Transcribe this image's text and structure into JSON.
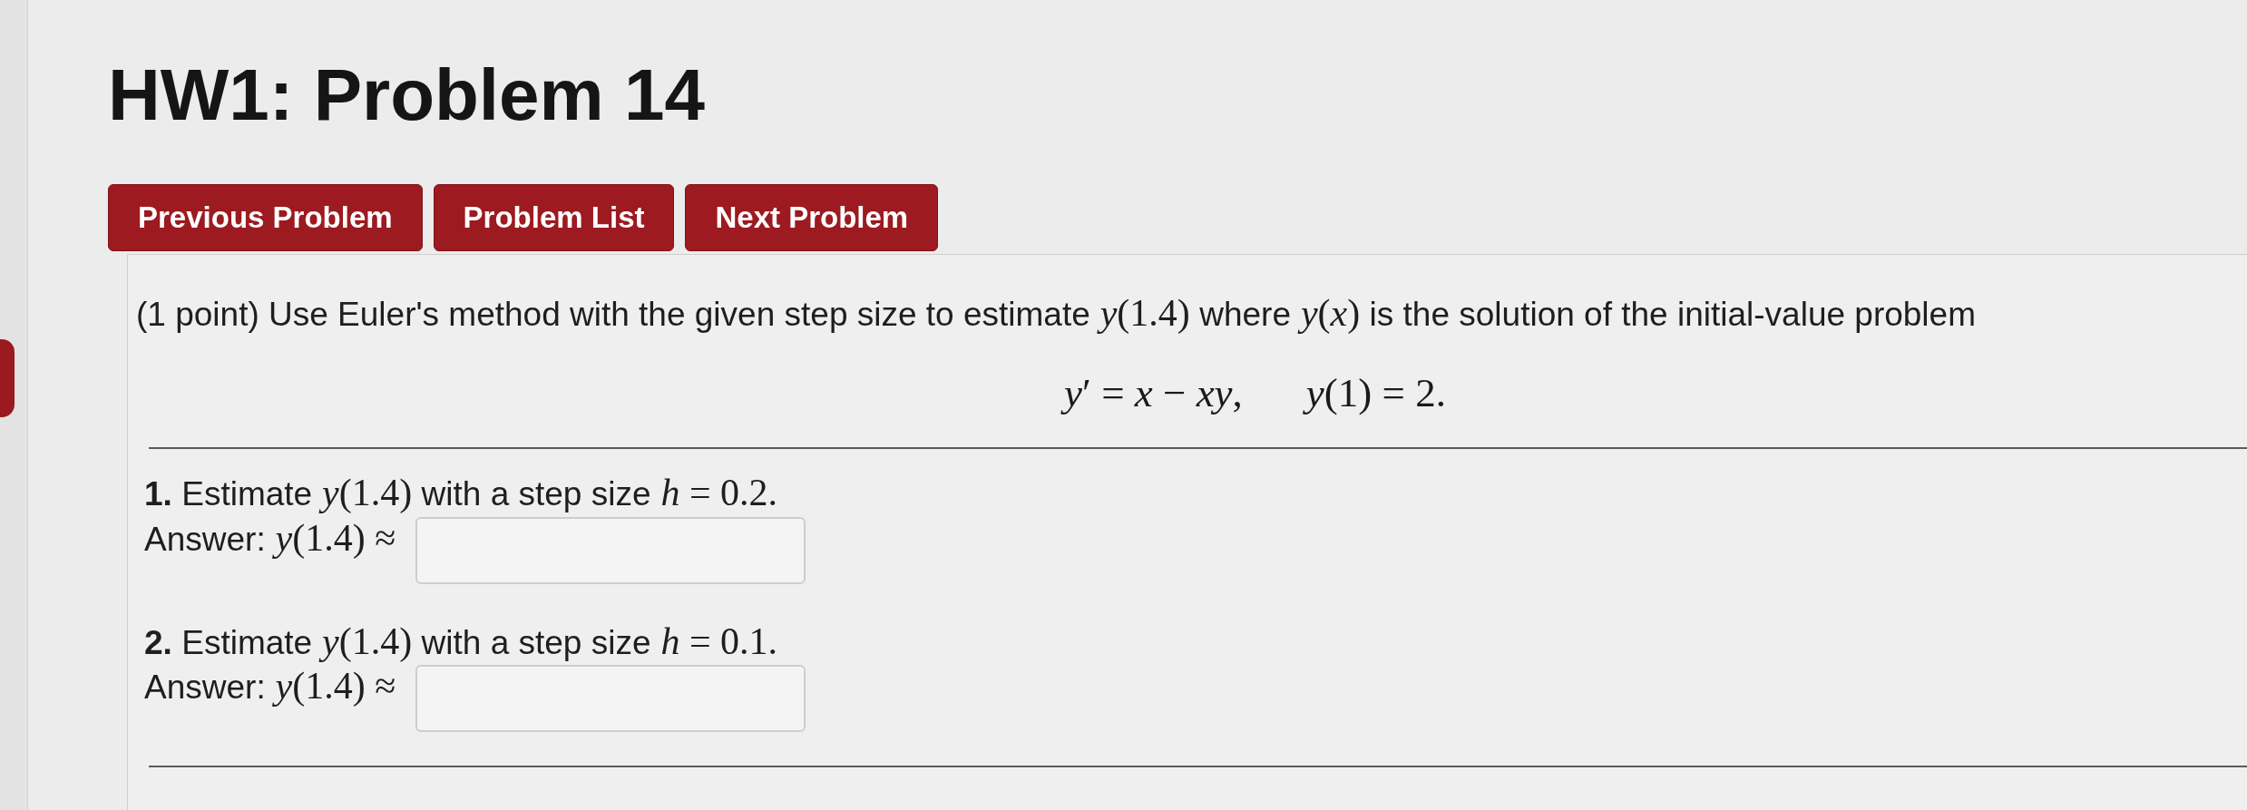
{
  "title": "HW1: Problem 14",
  "nav_buttons": [
    {
      "label": "Previous Problem"
    },
    {
      "label": "Problem List"
    },
    {
      "label": "Next Problem"
    }
  ],
  "problem": {
    "intro": [
      {
        "kind": "text",
        "text": "(1 point) Use Euler's method with the given step size to estimate"
      },
      {
        "kind": "math",
        "text": "*y*(1.4)"
      },
      {
        "kind": "text",
        "text": "where"
      },
      {
        "kind": "math",
        "text": "*y*(*x*)"
      },
      {
        "kind": "text",
        "text": "is the solution of the initial-value problem"
      }
    ],
    "equation": [
      "*y*′ = *x* − *xy*,",
      "*y*(1) = 2."
    ],
    "parts": [
      {
        "number": "1.",
        "prompt": [
          {
            "kind": "text",
            "text": "Estimate"
          },
          {
            "kind": "math",
            "text": "*y*(1.4)"
          },
          {
            "kind": "text",
            "text": "with a step size"
          },
          {
            "kind": "math",
            "text": "*h* = 0.2."
          }
        ],
        "answer_label": [
          {
            "kind": "text",
            "text": "Answer:"
          },
          {
            "kind": "math",
            "text": "*y*(1.4) ≈"
          }
        ]
      },
      {
        "number": "2.",
        "prompt": [
          {
            "kind": "text",
            "text": "Estimate"
          },
          {
            "kind": "math",
            "text": "*y*(1.4)"
          },
          {
            "kind": "text",
            "text": "with a step size"
          },
          {
            "kind": "math",
            "text": "*h* = 0.1."
          }
        ],
        "answer_label": [
          {
            "kind": "text",
            "text": "Answer:"
          },
          {
            "kind": "math",
            "text": "*y*(1.4) ≈"
          }
        ]
      }
    ]
  }
}
